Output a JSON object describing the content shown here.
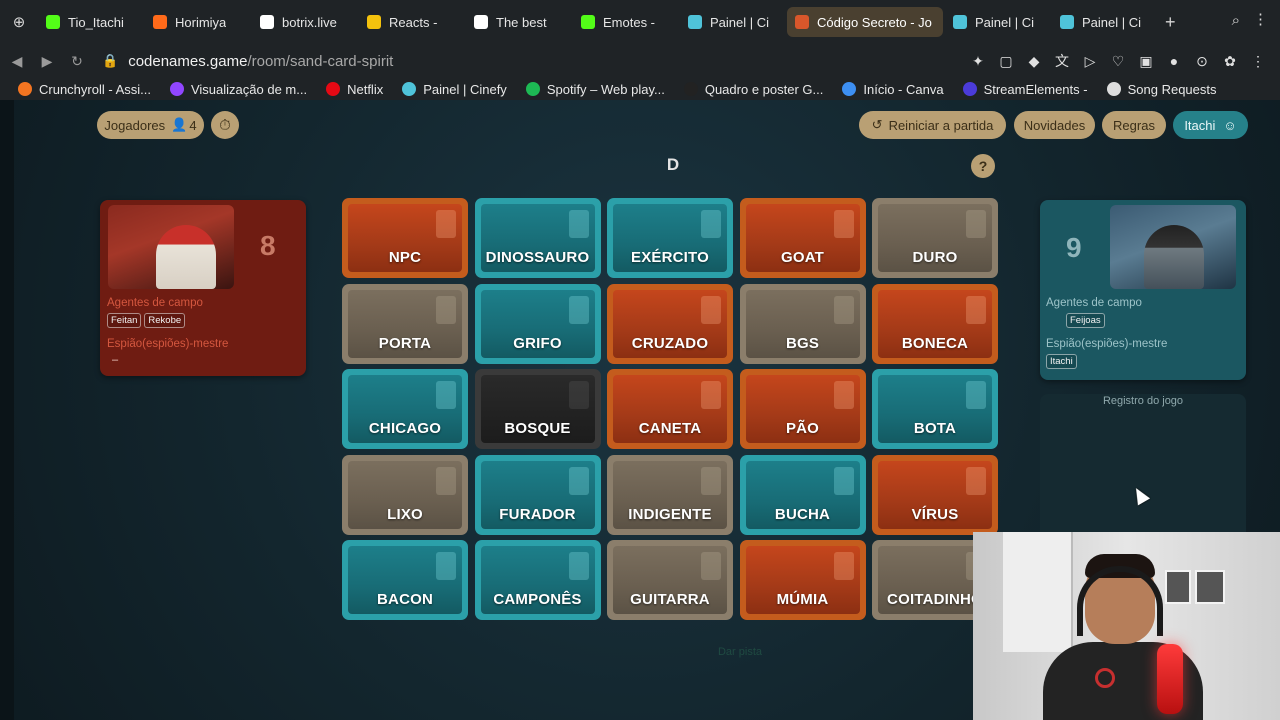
{
  "browser": {
    "tabs": [
      {
        "label": "Tio_Itachi",
        "color": "#53fc18",
        "active": false
      },
      {
        "label": "Horimiya",
        "color": "#ff6a1a",
        "active": false
      },
      {
        "label": "botrix.live",
        "color": "#ffffff",
        "active": false
      },
      {
        "label": "Reacts -",
        "color": "#f4c20d",
        "active": false
      },
      {
        "label": "The best",
        "color": "#ffffff",
        "active": false
      },
      {
        "label": "Emotes -",
        "color": "#53fc18",
        "active": false
      },
      {
        "label": "Painel | Ci",
        "color": "#4fc3d9",
        "active": false
      },
      {
        "label": "Código Secreto - Jo",
        "color": "#d9572b",
        "active": true
      },
      {
        "label": "Painel | Ci",
        "color": "#4fc3d9",
        "active": false
      },
      {
        "label": "Painel | Ci",
        "color": "#4fc3d9",
        "active": false
      }
    ],
    "url_host": "codenames.game",
    "url_path": "/room/sand-card-spirit",
    "bookmarks": [
      {
        "label": "Crunchyroll - Assi...",
        "color": "#f47521"
      },
      {
        "label": "Visualização de m...",
        "color": "#9146ff"
      },
      {
        "label": "Netflix",
        "color": "#e50914"
      },
      {
        "label": "Painel | Cinefy",
        "color": "#4fc3d9"
      },
      {
        "label": "Spotify – Web play...",
        "color": "#1db954"
      },
      {
        "label": "Quadro e poster G...",
        "color": "#222222"
      },
      {
        "label": "Início - Canva",
        "color": "#3d8ff2"
      },
      {
        "label": "StreamElements -",
        "color": "#4b3bd9"
      },
      {
        "label": "Song Requests",
        "color": "#dddddd"
      }
    ]
  },
  "game": {
    "players_label": "Jogadores",
    "players_count": "4",
    "restart_label": "Reiniciar a partida",
    "news_label": "Novidades",
    "rules_label": "Regras",
    "user_label": "Itachi",
    "clue": "D",
    "help": "?",
    "end_turn": "Dar pista",
    "log_title": "Registro do jogo",
    "red": {
      "score": "8",
      "agents_label": "Agentes de campo",
      "agents": [
        "Feitan",
        "Rekobe"
      ],
      "spymaster_label": "Espião(espiões)-mestre",
      "spymaster_value": "–"
    },
    "blue": {
      "score": "9",
      "agents_label": "Agentes de campo",
      "agents": [
        "Feijoas"
      ],
      "spymaster_label": "Espião(espiões)-mestre",
      "spymasters": [
        "Itachi"
      ]
    },
    "cards": [
      {
        "word": "NPC",
        "team": "red"
      },
      {
        "word": "DINOSSAURO",
        "team": "blue"
      },
      {
        "word": "EXÉRCITO",
        "team": "blue"
      },
      {
        "word": "GOAT",
        "team": "red"
      },
      {
        "word": "DURO",
        "team": "neutral"
      },
      {
        "word": "PORTA",
        "team": "neutral"
      },
      {
        "word": "GRIFO",
        "team": "blue"
      },
      {
        "word": "CRUZADO",
        "team": "red"
      },
      {
        "word": "BGS",
        "team": "neutral"
      },
      {
        "word": "BONECA",
        "team": "red"
      },
      {
        "word": "CHICAGO",
        "team": "blue"
      },
      {
        "word": "BOSQUE",
        "team": "assassin"
      },
      {
        "word": "CANETA",
        "team": "red"
      },
      {
        "word": "PÃO",
        "team": "red"
      },
      {
        "word": "BOTA",
        "team": "blue"
      },
      {
        "word": "LIXO",
        "team": "neutral"
      },
      {
        "word": "FURADOR",
        "team": "blue"
      },
      {
        "word": "INDIGENTE",
        "team": "neutral"
      },
      {
        "word": "BUCHA",
        "team": "blue"
      },
      {
        "word": "VÍRUS",
        "team": "red"
      },
      {
        "word": "BACON",
        "team": "blue"
      },
      {
        "word": "CAMPONÊS",
        "team": "blue"
      },
      {
        "word": "GUITARRA",
        "team": "neutral"
      },
      {
        "word": "MÚMIA",
        "team": "red"
      },
      {
        "word": "COITADINHO",
        "team": "neutral"
      }
    ]
  }
}
